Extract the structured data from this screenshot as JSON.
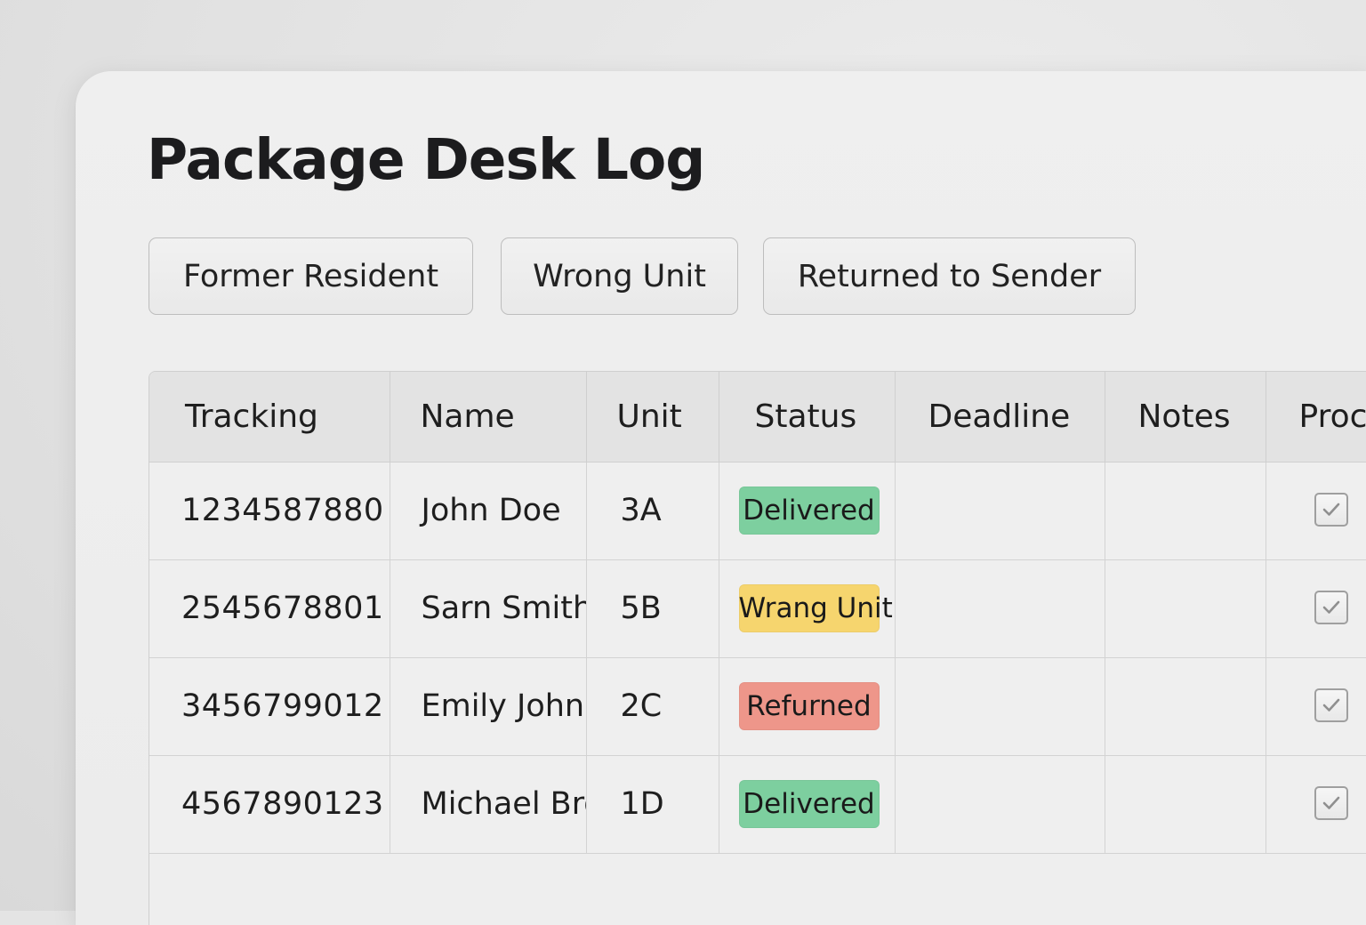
{
  "page": {
    "title": "Package Desk Log"
  },
  "filters": [
    {
      "label": "Former Resident"
    },
    {
      "label": "Wrong Unit"
    },
    {
      "label": "Returned to Sender"
    }
  ],
  "table": {
    "columns": [
      "Tracking",
      "Name",
      "Unit",
      "Status",
      "Deadline",
      "Notes",
      "Proc"
    ],
    "rows": [
      {
        "tracking": "1234587880",
        "name": "John Doe",
        "unit": "3A",
        "status": "Delivered",
        "status_color": "#7dcf9f",
        "deadline": "",
        "notes": "",
        "processed": true
      },
      {
        "tracking": "2545678801",
        "name": "Sarn Smith",
        "unit": "5B",
        "status": "Wrang Unit",
        "status_color": "#f6d56e",
        "deadline": "",
        "notes": "",
        "processed": true
      },
      {
        "tracking": "3456799012",
        "name": "Emily Johns",
        "unit": "2C",
        "status": "Refurned",
        "status_color": "#ee968a",
        "deadline": "",
        "notes": "",
        "processed": true
      },
      {
        "tracking": "4567890123",
        "name": "Michael Bro",
        "unit": "1D",
        "status": "Delivered",
        "status_color": "#7dcf9f",
        "deadline": "",
        "notes": "",
        "processed": true
      }
    ]
  },
  "icons": {
    "processed_checkbox": "checkmark-icon"
  }
}
